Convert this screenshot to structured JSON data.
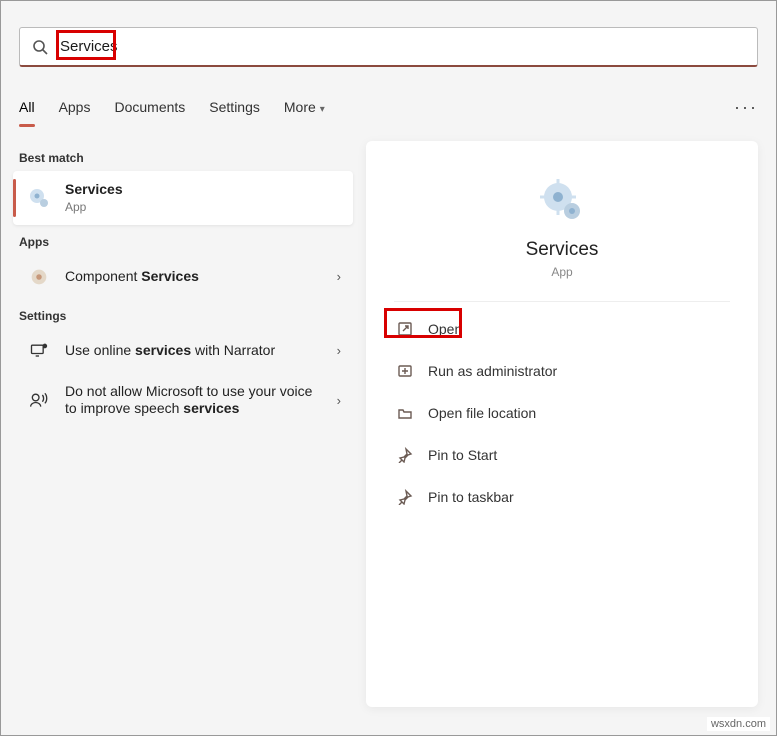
{
  "search": {
    "query": "Services"
  },
  "tabs": {
    "items": [
      "All",
      "Apps",
      "Documents",
      "Settings",
      "More"
    ],
    "active": 0
  },
  "results": {
    "best_label": "Best match",
    "best": {
      "title": "Services",
      "subtitle": "App"
    },
    "groups": [
      {
        "label": "Apps",
        "items": [
          {
            "prefix": "Component ",
            "bold": "Services",
            "suffix": ""
          }
        ]
      },
      {
        "label": "Settings",
        "items": [
          {
            "prefix": "Use online ",
            "bold": "services",
            "suffix": " with Narrator"
          },
          {
            "prefix": "Do not allow Microsoft to use your voice to improve speech ",
            "bold": "services",
            "suffix": ""
          }
        ]
      }
    ]
  },
  "detail": {
    "title": "Services",
    "subtitle": "App",
    "actions": [
      {
        "id": "open",
        "label": "Open",
        "highlight": true
      },
      {
        "id": "run-admin",
        "label": "Run as administrator"
      },
      {
        "id": "open-location",
        "label": "Open file location"
      },
      {
        "id": "pin-start",
        "label": "Pin to Start"
      },
      {
        "id": "pin-taskbar",
        "label": "Pin to taskbar"
      }
    ]
  },
  "watermark": "wsxdn.com"
}
